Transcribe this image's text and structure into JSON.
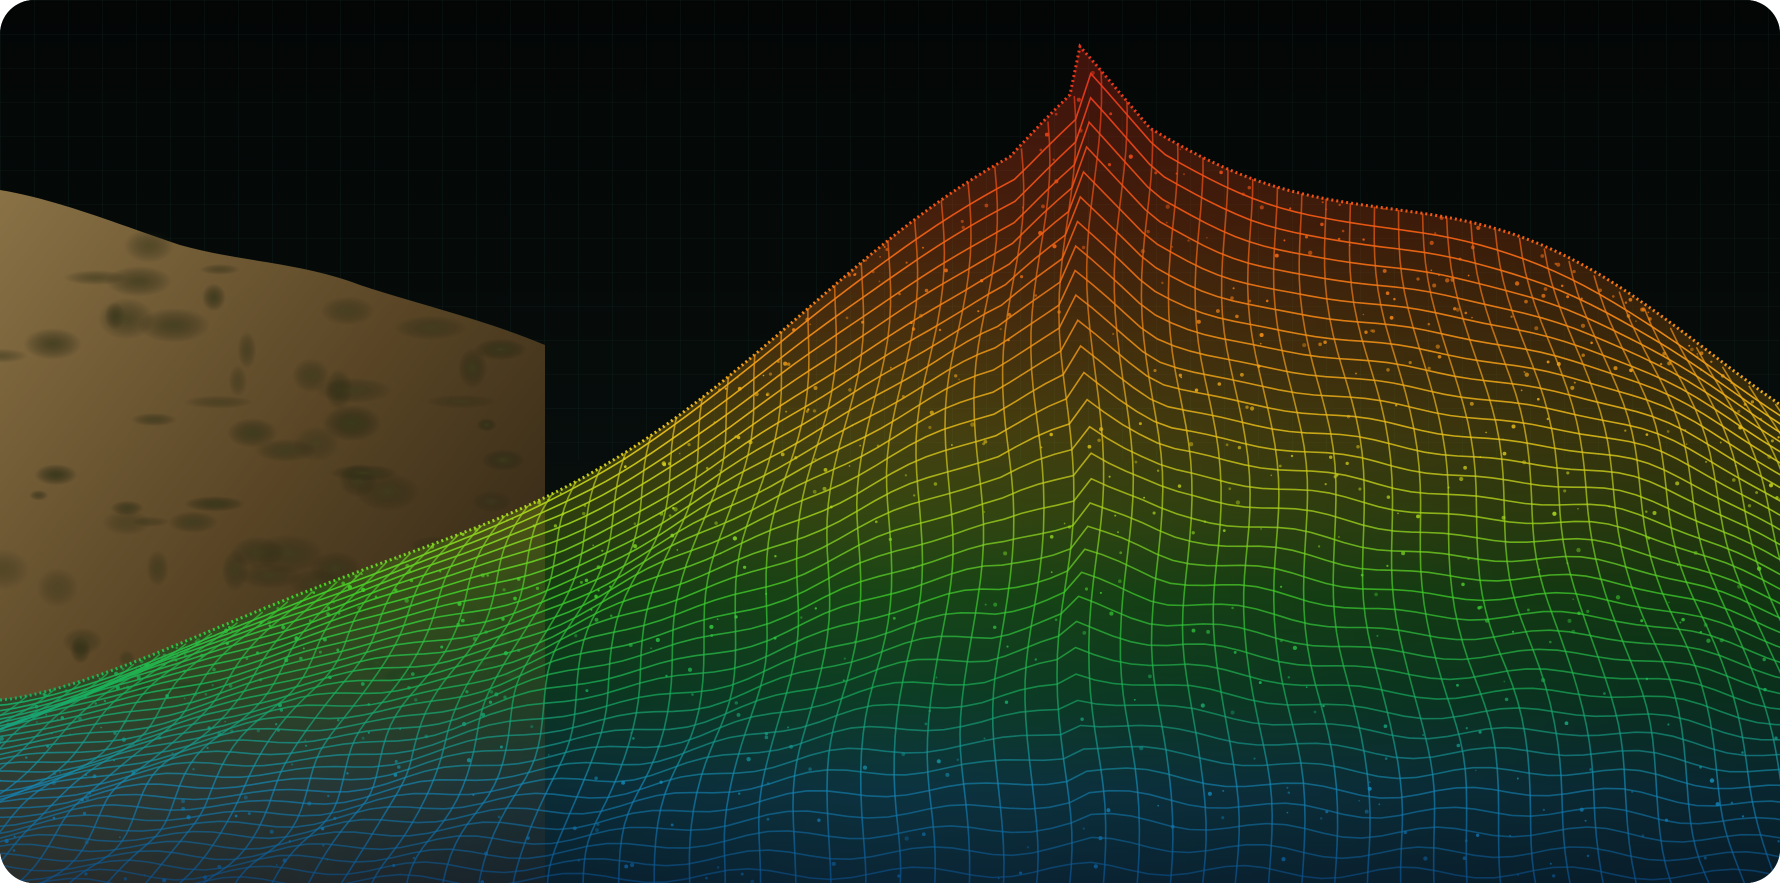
{
  "image": {
    "subject": "terrain-wireframe-mesh",
    "palette": {
      "sky": "#050908",
      "sky_grid": "#1b3a36",
      "hill_dark": "#2c2213",
      "hill_mid": "#5a4626",
      "hill_light": "#8a7246",
      "peak": "#e8361c",
      "high": "#f26a16",
      "mid_high": "#f2a418",
      "mid": "#c8d81a",
      "mid_low": "#3fcf2a",
      "low": "#18b05a",
      "base": "#1487b8",
      "deep": "#0b4f8e"
    }
  }
}
